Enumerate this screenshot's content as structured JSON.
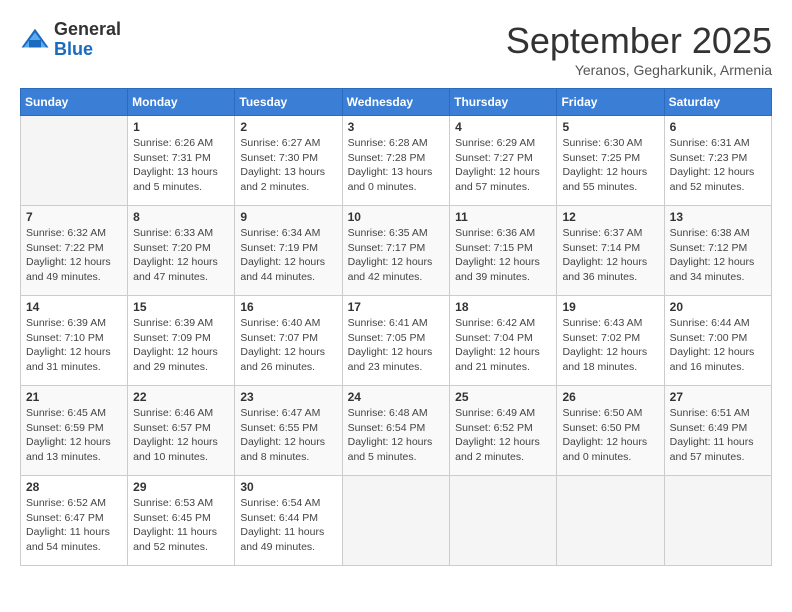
{
  "logo": {
    "general": "General",
    "blue": "Blue"
  },
  "header": {
    "month_title": "September 2025",
    "subtitle": "Yeranos, Gegharkunik, Armenia"
  },
  "weekdays": [
    "Sunday",
    "Monday",
    "Tuesday",
    "Wednesday",
    "Thursday",
    "Friday",
    "Saturday"
  ],
  "weeks": [
    [
      {
        "day": "",
        "sunrise": "",
        "sunset": "",
        "daylight": ""
      },
      {
        "day": "1",
        "sunrise": "Sunrise: 6:26 AM",
        "sunset": "Sunset: 7:31 PM",
        "daylight": "Daylight: 13 hours and 5 minutes."
      },
      {
        "day": "2",
        "sunrise": "Sunrise: 6:27 AM",
        "sunset": "Sunset: 7:30 PM",
        "daylight": "Daylight: 13 hours and 2 minutes."
      },
      {
        "day": "3",
        "sunrise": "Sunrise: 6:28 AM",
        "sunset": "Sunset: 7:28 PM",
        "daylight": "Daylight: 13 hours and 0 minutes."
      },
      {
        "day": "4",
        "sunrise": "Sunrise: 6:29 AM",
        "sunset": "Sunset: 7:27 PM",
        "daylight": "Daylight: 12 hours and 57 minutes."
      },
      {
        "day": "5",
        "sunrise": "Sunrise: 6:30 AM",
        "sunset": "Sunset: 7:25 PM",
        "daylight": "Daylight: 12 hours and 55 minutes."
      },
      {
        "day": "6",
        "sunrise": "Sunrise: 6:31 AM",
        "sunset": "Sunset: 7:23 PM",
        "daylight": "Daylight: 12 hours and 52 minutes."
      }
    ],
    [
      {
        "day": "7",
        "sunrise": "Sunrise: 6:32 AM",
        "sunset": "Sunset: 7:22 PM",
        "daylight": "Daylight: 12 hours and 49 minutes."
      },
      {
        "day": "8",
        "sunrise": "Sunrise: 6:33 AM",
        "sunset": "Sunset: 7:20 PM",
        "daylight": "Daylight: 12 hours and 47 minutes."
      },
      {
        "day": "9",
        "sunrise": "Sunrise: 6:34 AM",
        "sunset": "Sunset: 7:19 PM",
        "daylight": "Daylight: 12 hours and 44 minutes."
      },
      {
        "day": "10",
        "sunrise": "Sunrise: 6:35 AM",
        "sunset": "Sunset: 7:17 PM",
        "daylight": "Daylight: 12 hours and 42 minutes."
      },
      {
        "day": "11",
        "sunrise": "Sunrise: 6:36 AM",
        "sunset": "Sunset: 7:15 PM",
        "daylight": "Daylight: 12 hours and 39 minutes."
      },
      {
        "day": "12",
        "sunrise": "Sunrise: 6:37 AM",
        "sunset": "Sunset: 7:14 PM",
        "daylight": "Daylight: 12 hours and 36 minutes."
      },
      {
        "day": "13",
        "sunrise": "Sunrise: 6:38 AM",
        "sunset": "Sunset: 7:12 PM",
        "daylight": "Daylight: 12 hours and 34 minutes."
      }
    ],
    [
      {
        "day": "14",
        "sunrise": "Sunrise: 6:39 AM",
        "sunset": "Sunset: 7:10 PM",
        "daylight": "Daylight: 12 hours and 31 minutes."
      },
      {
        "day": "15",
        "sunrise": "Sunrise: 6:39 AM",
        "sunset": "Sunset: 7:09 PM",
        "daylight": "Daylight: 12 hours and 29 minutes."
      },
      {
        "day": "16",
        "sunrise": "Sunrise: 6:40 AM",
        "sunset": "Sunset: 7:07 PM",
        "daylight": "Daylight: 12 hours and 26 minutes."
      },
      {
        "day": "17",
        "sunrise": "Sunrise: 6:41 AM",
        "sunset": "Sunset: 7:05 PM",
        "daylight": "Daylight: 12 hours and 23 minutes."
      },
      {
        "day": "18",
        "sunrise": "Sunrise: 6:42 AM",
        "sunset": "Sunset: 7:04 PM",
        "daylight": "Daylight: 12 hours and 21 minutes."
      },
      {
        "day": "19",
        "sunrise": "Sunrise: 6:43 AM",
        "sunset": "Sunset: 7:02 PM",
        "daylight": "Daylight: 12 hours and 18 minutes."
      },
      {
        "day": "20",
        "sunrise": "Sunrise: 6:44 AM",
        "sunset": "Sunset: 7:00 PM",
        "daylight": "Daylight: 12 hours and 16 minutes."
      }
    ],
    [
      {
        "day": "21",
        "sunrise": "Sunrise: 6:45 AM",
        "sunset": "Sunset: 6:59 PM",
        "daylight": "Daylight: 12 hours and 13 minutes."
      },
      {
        "day": "22",
        "sunrise": "Sunrise: 6:46 AM",
        "sunset": "Sunset: 6:57 PM",
        "daylight": "Daylight: 12 hours and 10 minutes."
      },
      {
        "day": "23",
        "sunrise": "Sunrise: 6:47 AM",
        "sunset": "Sunset: 6:55 PM",
        "daylight": "Daylight: 12 hours and 8 minutes."
      },
      {
        "day": "24",
        "sunrise": "Sunrise: 6:48 AM",
        "sunset": "Sunset: 6:54 PM",
        "daylight": "Daylight: 12 hours and 5 minutes."
      },
      {
        "day": "25",
        "sunrise": "Sunrise: 6:49 AM",
        "sunset": "Sunset: 6:52 PM",
        "daylight": "Daylight: 12 hours and 2 minutes."
      },
      {
        "day": "26",
        "sunrise": "Sunrise: 6:50 AM",
        "sunset": "Sunset: 6:50 PM",
        "daylight": "Daylight: 12 hours and 0 minutes."
      },
      {
        "day": "27",
        "sunrise": "Sunrise: 6:51 AM",
        "sunset": "Sunset: 6:49 PM",
        "daylight": "Daylight: 11 hours and 57 minutes."
      }
    ],
    [
      {
        "day": "28",
        "sunrise": "Sunrise: 6:52 AM",
        "sunset": "Sunset: 6:47 PM",
        "daylight": "Daylight: 11 hours and 54 minutes."
      },
      {
        "day": "29",
        "sunrise": "Sunrise: 6:53 AM",
        "sunset": "Sunset: 6:45 PM",
        "daylight": "Daylight: 11 hours and 52 minutes."
      },
      {
        "day": "30",
        "sunrise": "Sunrise: 6:54 AM",
        "sunset": "Sunset: 6:44 PM",
        "daylight": "Daylight: 11 hours and 49 minutes."
      },
      {
        "day": "",
        "sunrise": "",
        "sunset": "",
        "daylight": ""
      },
      {
        "day": "",
        "sunrise": "",
        "sunset": "",
        "daylight": ""
      },
      {
        "day": "",
        "sunrise": "",
        "sunset": "",
        "daylight": ""
      },
      {
        "day": "",
        "sunrise": "",
        "sunset": "",
        "daylight": ""
      }
    ]
  ]
}
